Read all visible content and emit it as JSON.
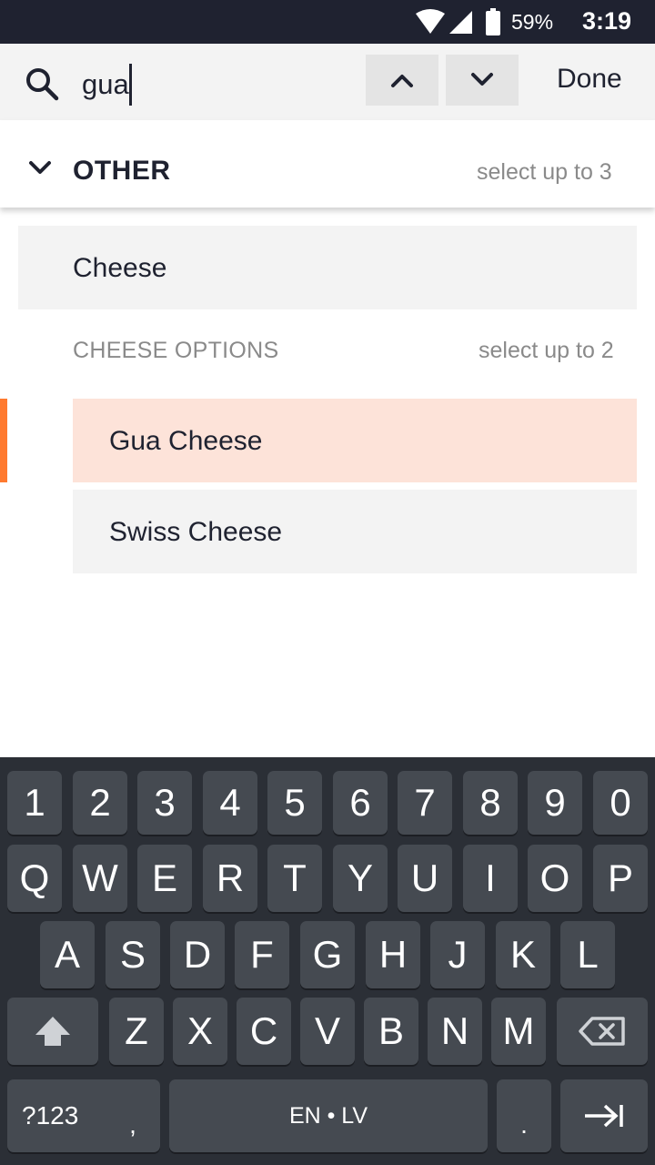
{
  "status_bar": {
    "battery_text": "59%",
    "time": "3:19"
  },
  "search": {
    "query": "gua",
    "done_label": "Done"
  },
  "section": {
    "title": "OTHER",
    "limit_text": "select up to 3"
  },
  "items": {
    "cheese_label": "Cheese",
    "options_title": "CHEESE OPTIONS",
    "options_limit": "select up to 2",
    "gua_label": "Gua Cheese",
    "swiss_label": "Swiss Cheese"
  },
  "keyboard": {
    "row_numbers": [
      "1",
      "2",
      "3",
      "4",
      "5",
      "6",
      "7",
      "8",
      "9",
      "0"
    ],
    "row_q": [
      "Q",
      "W",
      "E",
      "R",
      "T",
      "Y",
      "U",
      "I",
      "O",
      "P"
    ],
    "row_a": [
      "A",
      "S",
      "D",
      "F",
      "G",
      "H",
      "J",
      "K",
      "L"
    ],
    "row_z": [
      "Z",
      "X",
      "C",
      "V",
      "B",
      "N",
      "M"
    ],
    "symbols_label": "?123",
    "comma_label": ",",
    "space_label": "EN • LV",
    "period_label": "."
  },
  "colors": {
    "status_bg": "#1f2230",
    "highlight_accent": "#ff7a2f",
    "highlight_row": "#fde3d9",
    "keyboard_bg": "#2b2f36",
    "key_bg": "#454a51"
  }
}
